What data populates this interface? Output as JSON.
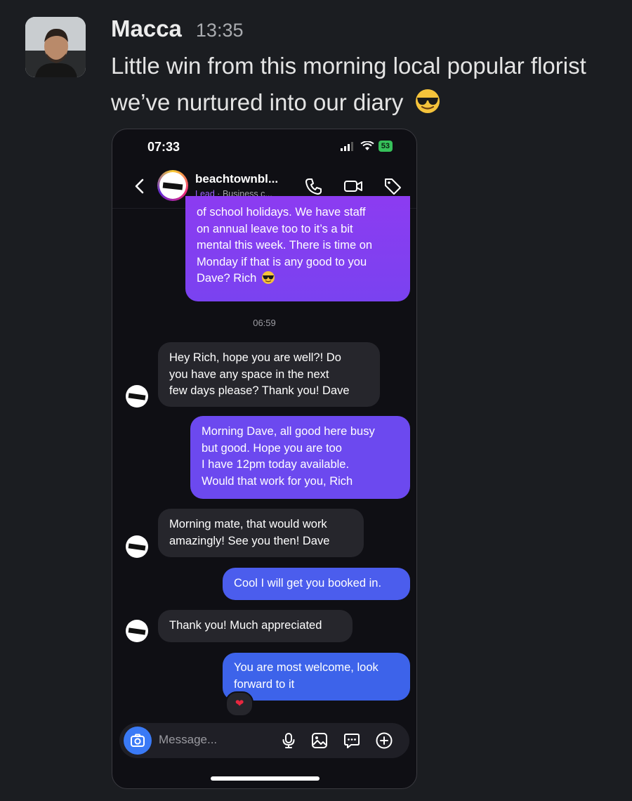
{
  "message": {
    "sender": "Macca",
    "time": "13:35",
    "text": "Little win from this morning local popular florist we’ve nurtured into our diary",
    "emoji": "smiling-face-with-sunglasses"
  },
  "phone": {
    "status": {
      "time": "07:33",
      "battery": "53"
    },
    "header": {
      "contact_name": "beachtownbl...",
      "lead_label": "Lead",
      "separator": "·",
      "subtitle": "Business c..."
    },
    "messages": [
      {
        "dir": "out",
        "text": "of school holidays. We have staff\non annual leave too to it’s a bit\nmental this week. There is time on\nMonday if that is any good to you\nDave? Rich",
        "emoji": "sunglasses"
      },
      {
        "dir": "divider",
        "text": "06:59"
      },
      {
        "dir": "in",
        "text": "Hey Rich, hope you are well?! Do\nyou have any space in the next\nfew days please? Thank you! Dave"
      },
      {
        "dir": "out",
        "text": "Morning Dave, all good here busy\nbut good. Hope you are too\nI have 12pm today available.\nWould that work for you, Rich"
      },
      {
        "dir": "in",
        "text": "Morning mate, that would work\namazingly! See you then! Dave"
      },
      {
        "dir": "out",
        "text": "Cool I will get you booked in."
      },
      {
        "dir": "in",
        "text": "Thank you! Much appreciated"
      },
      {
        "dir": "out",
        "text": "You are most welcome, look\nforward to it",
        "reaction": "❤"
      }
    ],
    "composer": {
      "placeholder": "Message..."
    }
  },
  "colors": {
    "background": "#1b1d21",
    "outgoing_top": "#8b3cf0",
    "outgoing_bottom": "#3d63ea",
    "incoming": "#26262c",
    "lead": "#9d63ff",
    "camera_button": "#3a7af6"
  }
}
